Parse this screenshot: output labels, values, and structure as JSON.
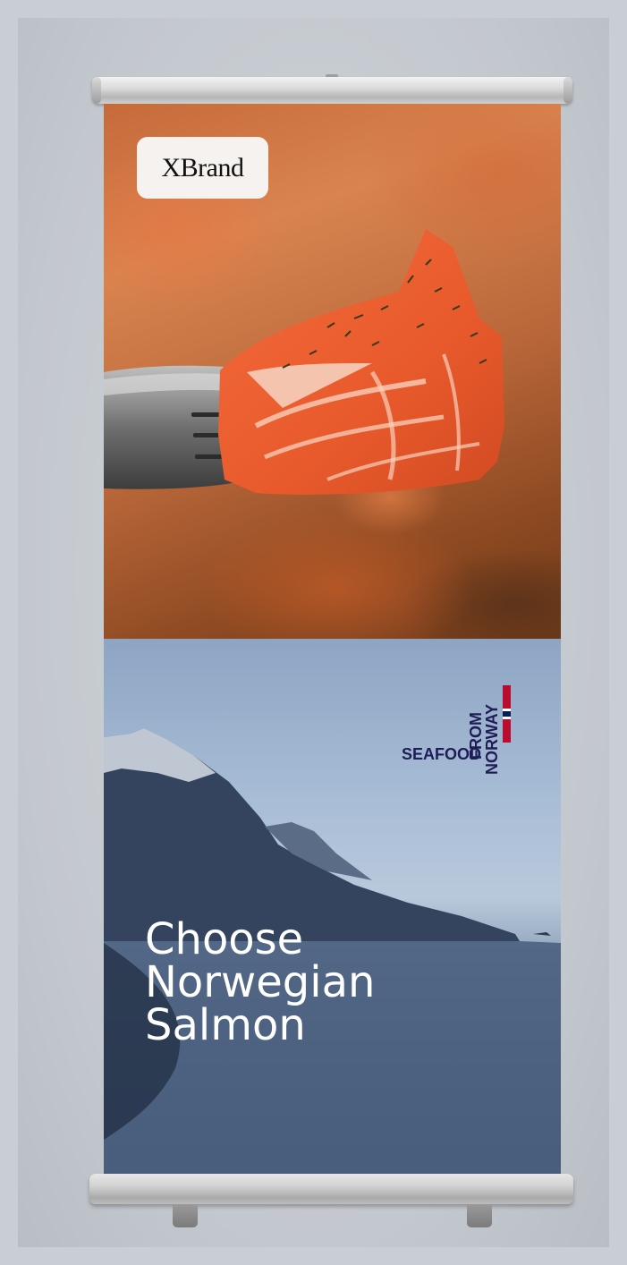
{
  "banner": {
    "brand_label": "XBrand",
    "headline_lines": [
      "Choose",
      "Norwegian",
      "Salmon"
    ],
    "logo": {
      "word_seafood": "SEAFOOD",
      "word_from": "FROM",
      "word_norway": "NORWAY",
      "icon": "norwegian-flag-icon",
      "text_color": "#1f1d57",
      "flag_colors": [
        "#ba0c2f",
        "#ffffff",
        "#00205b"
      ]
    }
  }
}
